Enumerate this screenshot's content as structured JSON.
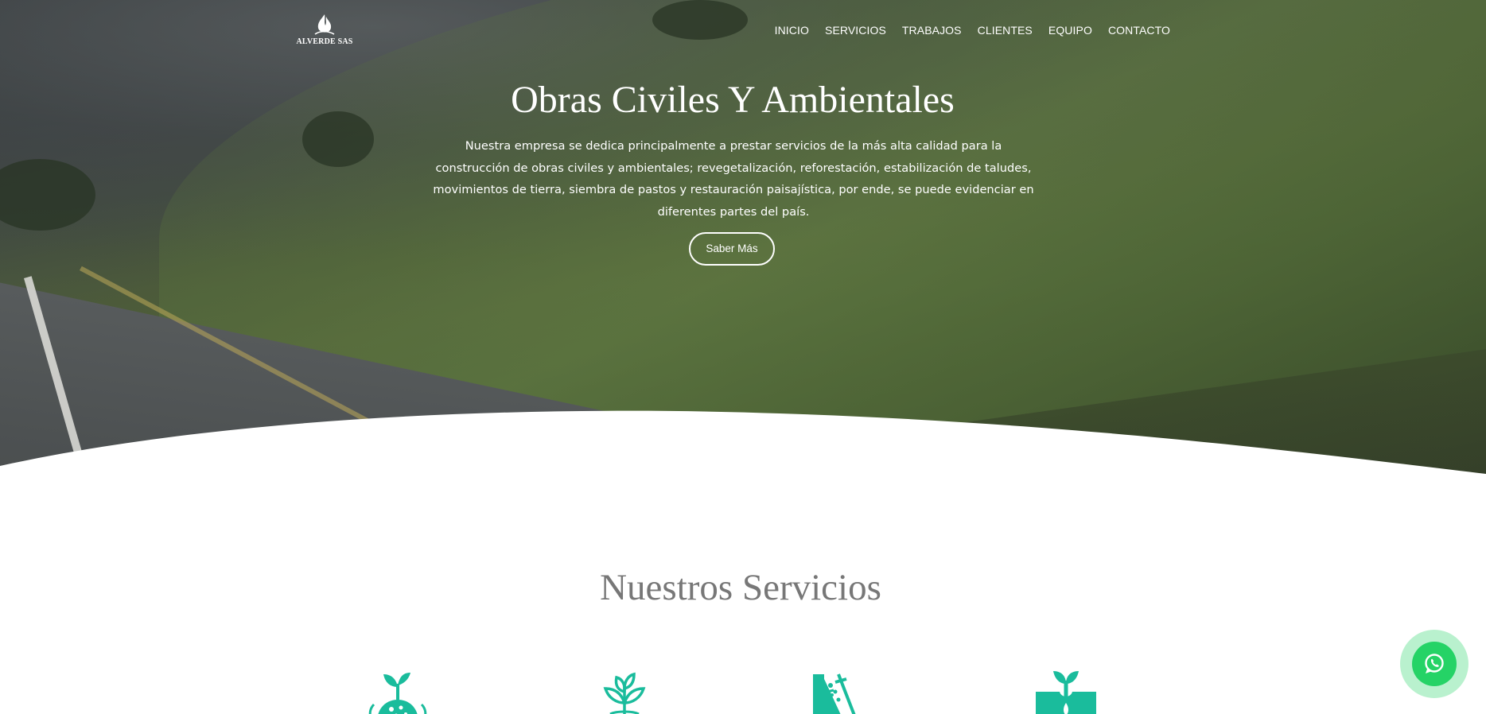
{
  "brand": {
    "logo_text": "ALVERDE SAS"
  },
  "nav": {
    "items": [
      {
        "label": "INICIO"
      },
      {
        "label": "SERVICIOS"
      },
      {
        "label": "TRABAJOS"
      },
      {
        "label": "CLIENTES"
      },
      {
        "label": "EQUIPO"
      },
      {
        "label": "CONTACTO"
      }
    ]
  },
  "hero": {
    "title": "Obras Civiles Y Ambientales",
    "description": "Nuestra empresa se dedica principalmente a prestar servicios de la más alta calidad para la construcción de obras civiles y ambientales; revegetalización, reforestación, estabilización de taludes, movimientos de tierra, siembra de pastos y restauración paisajística, por ende, se puede evidenciar en diferentes partes del país.",
    "cta_label": "Saber Más"
  },
  "services": {
    "title": "Nuestros Servicios",
    "icons": [
      "seedling-soil-icon",
      "plant-roots-icon",
      "slope-stabilization-icon",
      "sprout-ground-icon"
    ]
  },
  "colors": {
    "accent": "#1abc9c",
    "whatsapp": "#25d366",
    "services_title": "#777777"
  },
  "floating": {
    "icon": "whatsapp-icon"
  }
}
